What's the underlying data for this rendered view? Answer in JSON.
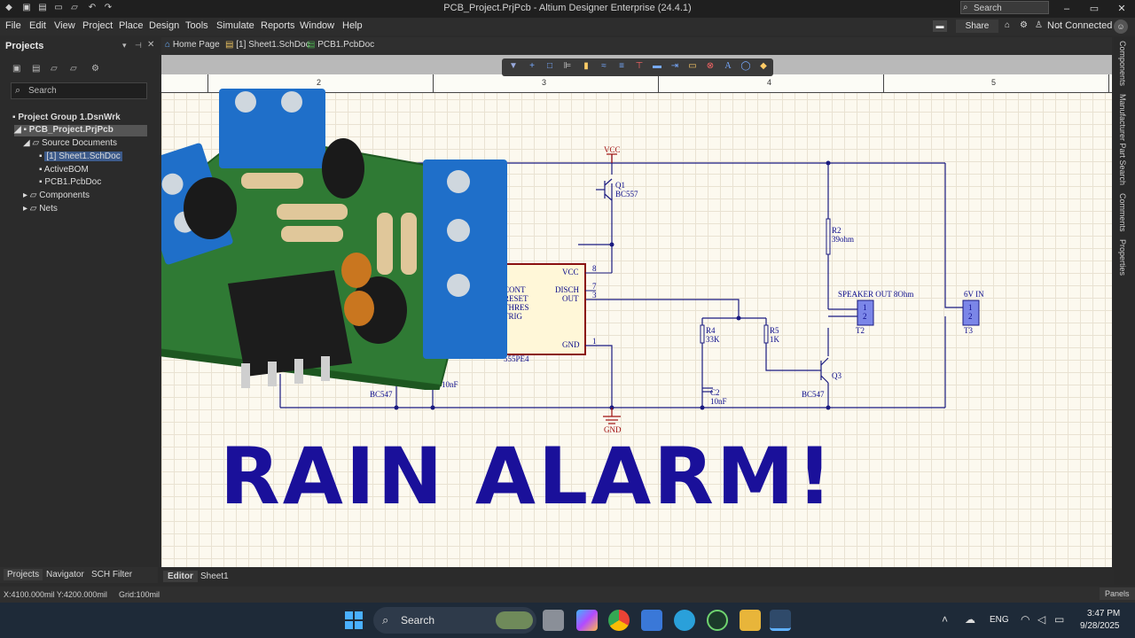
{
  "window": {
    "title": "PCB_Project.PrjPcb - Altium Designer Enterprise (24.4.1)",
    "search_placeholder": "Search",
    "controls": [
      "–",
      "▭",
      "✕"
    ]
  },
  "menu": [
    "File",
    "Edit",
    "View",
    "Project",
    "Place",
    "Design",
    "Tools",
    "Simulate",
    "Reports",
    "Window",
    "Help"
  ],
  "menu_right": {
    "share": "Share",
    "connection": "Not Connected"
  },
  "projects_panel": {
    "title": "Projects",
    "search_placeholder": "Search",
    "tree": [
      {
        "label": "Project Group 1.DsnWrk",
        "level": 0,
        "bold": true
      },
      {
        "label": "PCB_Project.PrjPcb",
        "level": 1,
        "bold": true,
        "selected": true
      },
      {
        "label": "Source Documents",
        "level": 2
      },
      {
        "label": "[1] Sheet1.SchDoc",
        "level": 3,
        "selected": true
      },
      {
        "label": "ActiveBOM",
        "level": 3
      },
      {
        "label": "PCB1.PcbDoc",
        "level": 3
      },
      {
        "label": "Components",
        "level": 2
      },
      {
        "label": "Nets",
        "level": 2
      }
    ],
    "bottom_tabs": [
      "Projects",
      "Navigator",
      "SCH Filter"
    ]
  },
  "doc_tabs": [
    "Home Page",
    "[1] Sheet1.SchDoc",
    "PCB1.PcbDoc"
  ],
  "editor": {
    "zones": [
      "2",
      "3",
      "4",
      "5"
    ],
    "bottom_tabs": [
      "Editor",
      "Sheet1"
    ]
  },
  "schematic": {
    "vcc": "VCC",
    "gnd": "GND",
    "q1": "Q1",
    "q1_part": "BC557",
    "r2": "R2",
    "r2_val": "39ohm",
    "speaker_label": "SPEAKER OUT 8Ohm",
    "t2": "T2",
    "pin1": "1",
    "pin2": "2",
    "input_label": "6V IN",
    "t3": "T3",
    "ic_pins_left": [
      "CONT",
      "RESET",
      "THRES",
      "TRIG"
    ],
    "ic_vcc": "VCC",
    "ic_disch": "DISCH",
    "ic_out": "OUT",
    "ic_gnd": "GND",
    "ic_part": "555PE4",
    "pin8": "8",
    "pin7": "7",
    "pin3": "3",
    "pin1b": "1",
    "r4": "R4",
    "r4_val": "33K",
    "r5": "R5",
    "r5_val": "1K",
    "q3": "Q3",
    "q3_part": "BC547",
    "c2": "C2",
    "c2_val": "10nF",
    "left_part": "BC547",
    "left_cap": "10nF"
  },
  "overlay_text": "RAIN ALARM!",
  "right_rail": [
    "Components",
    "Manufacturer Part Search",
    "Comments",
    "Properties"
  ],
  "status": {
    "coords": "X:4100.000mil Y:4200.000mil",
    "grid": "Grid:100mil",
    "panels": "Panels"
  },
  "taskbar": {
    "search": "Search",
    "lang": "ENG",
    "time": "3:47 PM",
    "date": "9/28/2025"
  }
}
